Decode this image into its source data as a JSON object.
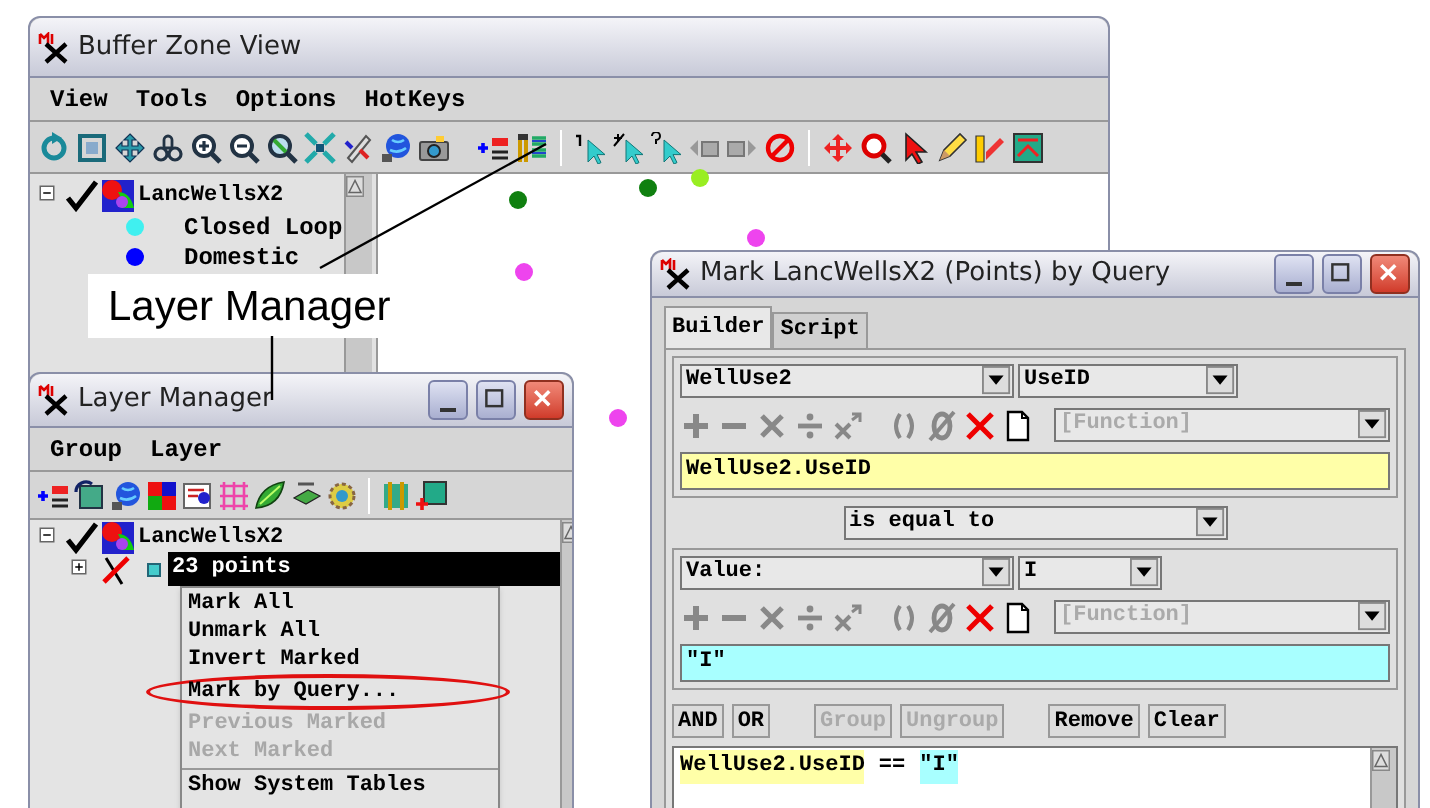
{
  "main_window": {
    "title": "Buffer Zone View",
    "menu": [
      "View",
      "Tools",
      "Options",
      "HotKeys"
    ],
    "legend": {
      "label": "LancWellsX2",
      "expanded": true,
      "checked": true,
      "items": [
        {
          "label": "Closed Loop",
          "color": "#40f0f0"
        },
        {
          "label": "Domestic",
          "color": "#0000ff"
        }
      ]
    }
  },
  "callout": {
    "label": "Layer Manager"
  },
  "layer_manager": {
    "title": "Layer Manager",
    "menu": [
      "Group",
      "Layer"
    ],
    "tree": {
      "label": "LancWellsX2",
      "expanded": true,
      "checked": true,
      "children": [
        {
          "label": "23 points",
          "expanded": false,
          "checked": false,
          "selected": true
        }
      ]
    }
  },
  "context_menu": {
    "items": [
      {
        "label": "Mark All",
        "disabled": false,
        "circled": false
      },
      {
        "label": "Unmark All",
        "disabled": false,
        "circled": false
      },
      {
        "label": "Invert Marked",
        "disabled": false,
        "circled": false
      },
      {
        "label": "Mark by Query...",
        "disabled": false,
        "circled": true
      },
      {
        "label": "Previous Marked",
        "disabled": true,
        "circled": false
      },
      {
        "label": "Next Marked",
        "disabled": true,
        "circled": false
      },
      {
        "label": "Show System Tables",
        "disabled": false,
        "circled": false
      }
    ]
  },
  "query_window": {
    "title": "Mark LancWellsX2 (Points) by Query",
    "tabs": [
      {
        "label": "Builder",
        "selected": true
      },
      {
        "label": "Script",
        "selected": false
      }
    ],
    "left_operand": {
      "table": "WellUse2",
      "field": "UseID",
      "function": "[Function]",
      "function_disabled": true,
      "expression": "WellUse2.UseID"
    },
    "operator": "is equal to",
    "right_operand": {
      "table": "Value:",
      "field": "I",
      "function": "[Function]",
      "function_disabled": true,
      "expression": "\"I\""
    },
    "buttons": [
      {
        "label": "AND",
        "disabled": false
      },
      {
        "label": "OR",
        "disabled": false
      },
      {
        "label": "Group",
        "disabled": true
      },
      {
        "label": "Ungroup",
        "disabled": true
      },
      {
        "label": "Remove",
        "disabled": false
      },
      {
        "label": "Clear",
        "disabled": false
      }
    ],
    "query": [
      {
        "text": "WellUse2.UseID",
        "kind": "field"
      },
      {
        "text": "==",
        "kind": "operator"
      },
      {
        "text": "\"I\"",
        "kind": "value"
      }
    ]
  }
}
